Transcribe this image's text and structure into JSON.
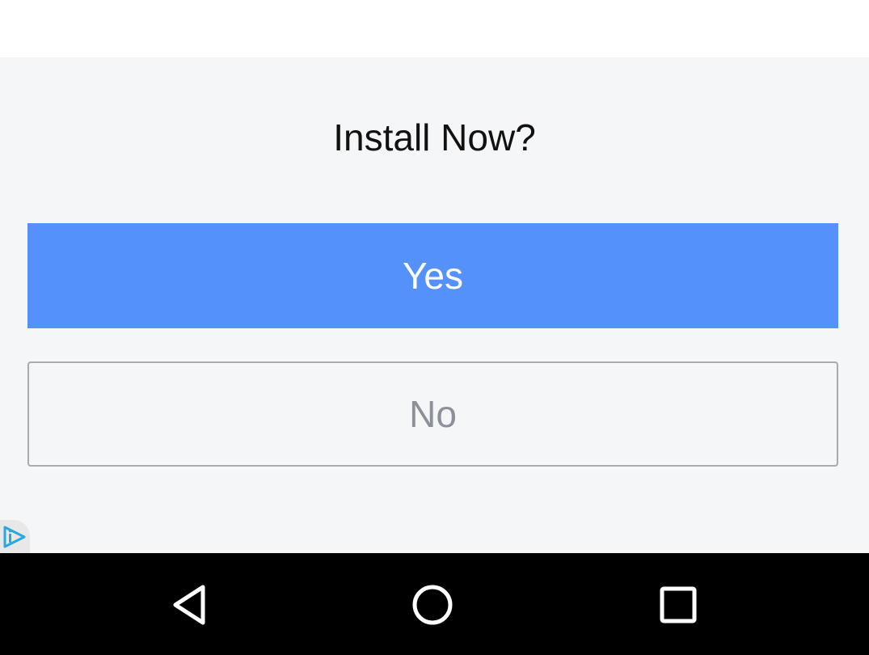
{
  "dialog": {
    "title": "Install Now?",
    "yes_label": "Yes",
    "no_label": "No"
  },
  "colors": {
    "primary": "#5591fb",
    "panel_background": "#f5f6f8",
    "secondary_text": "#8b9099",
    "navbar": "#000000"
  },
  "icons": {
    "ad_badge": "ad-choices-icon",
    "nav_back": "back-triangle-icon",
    "nav_home": "home-circle-icon",
    "nav_recent": "recents-square-icon"
  }
}
